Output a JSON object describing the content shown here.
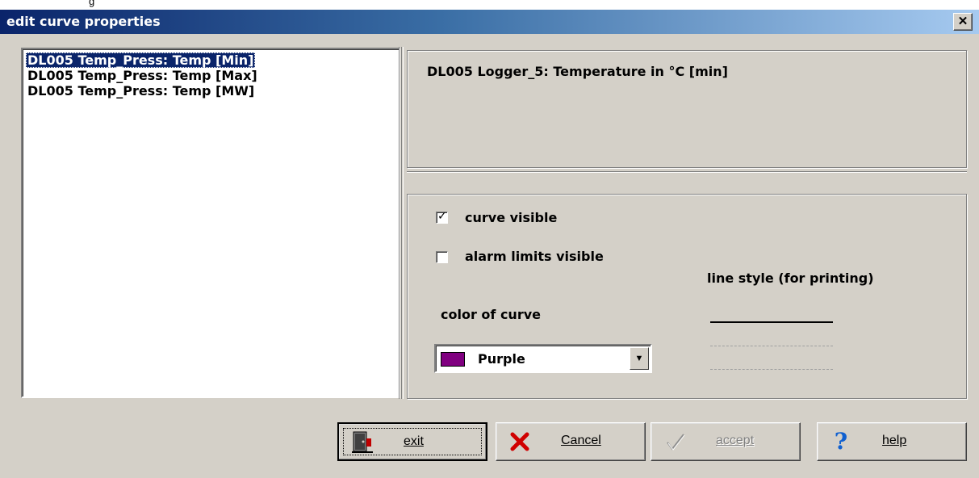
{
  "window": {
    "title": "edit curve properties",
    "close_glyph": "✕",
    "background_caption": "g"
  },
  "curves": {
    "items": [
      {
        "label": "DL005 Temp_Press: Temp [Min]",
        "selected": true
      },
      {
        "label": "DL005 Temp_Press: Temp [Max]",
        "selected": false
      },
      {
        "label": "DL005 Temp_Press: Temp [MW]",
        "selected": false
      }
    ]
  },
  "description": "DL005 Logger_5: Temperature in °C [min]",
  "properties": {
    "curve_visible": {
      "label": "curve visible",
      "checked": true
    },
    "alarm_limits_visible": {
      "label": "alarm limits visible",
      "checked": false
    },
    "color_label": "color of curve",
    "color_value": "Purple",
    "color_hex": "#800080",
    "line_style_label": "line style (for printing)",
    "line_styles": [
      "solid",
      "dashed",
      "dash-dot"
    ]
  },
  "buttons": {
    "exit": {
      "label": "exit",
      "icon": "exit-door-icon"
    },
    "cancel": {
      "label": "Cancel",
      "icon": "red-x-icon"
    },
    "accept": {
      "label": "accept",
      "icon": "checkmark-icon",
      "enabled": false
    },
    "help": {
      "label": "help",
      "icon": "question-mark-icon"
    }
  }
}
